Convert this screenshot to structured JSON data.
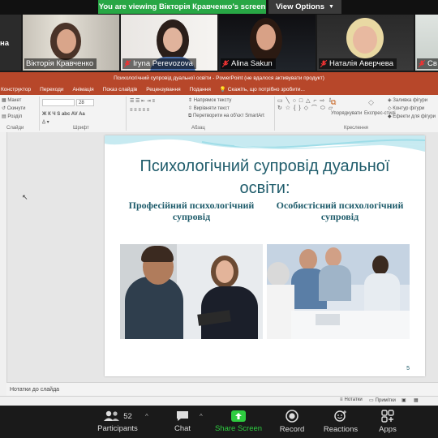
{
  "banner": {
    "viewing_text": "You are viewing Вікторія Кравченко's screen",
    "view_options_label": "View Options"
  },
  "participants": [
    {
      "name": "Вікторія Кравченко",
      "muted": false,
      "active": true
    },
    {
      "name": "Iryna Perevozova",
      "muted": true,
      "active": false
    },
    {
      "name": "Alina Sakun",
      "muted": true,
      "active": false
    },
    {
      "name": "Наталія Аверчева",
      "muted": true,
      "active": false
    },
    {
      "name": "Св",
      "muted": true,
      "active": false
    }
  ],
  "left_tile_fragment": "на",
  "powerpoint": {
    "window_title": "Психологічний супровід дуальної освіти - PowerPoint (не вдалося активувати продукт)",
    "tabs": [
      "Конструктор",
      "Переходи",
      "Анімація",
      "Показ слайдів",
      "Рецензування",
      "Подання"
    ],
    "tell_me": "Скажіть, що потрібно зробити...",
    "ribbon": {
      "slides_buttons": [
        "Макет",
        "Скинути",
        "Розділ"
      ],
      "slides_group": "Слайди",
      "font_size": "28",
      "font_group": "Шрифт",
      "paragraph_buttons": [
        "Напрямок тексту",
        "Вирівняти текст",
        "Перетворити на об'єкт SmartArt"
      ],
      "paragraph_group": "Абзац",
      "arrange_label": "Упорядкувати",
      "quick_styles_label": "Експрес-стилі",
      "drawing_buttons": [
        "Заливка фігури",
        "Контур фігури",
        "Ефекти для фігури"
      ],
      "drawing_group": "Креслення"
    },
    "notes_placeholder": "Нотатки до слайда",
    "status": {
      "notes": "Нотатки",
      "comments": "Примітки"
    }
  },
  "slide": {
    "title": "Психологічний супровід дуальної освіти:",
    "left_heading": "Професійний психологічний супровід",
    "right_heading": "Особистісний психологічний супровід",
    "number": "5"
  },
  "toolbar": {
    "participants_count": "52",
    "items": [
      "Participants",
      "Chat",
      "Share Screen",
      "Record",
      "Reactions",
      "Apps"
    ]
  },
  "colors": {
    "share_green": "#2ecc40",
    "ppt_red": "#b7472a",
    "slide_teal": "#1f5c6b"
  }
}
